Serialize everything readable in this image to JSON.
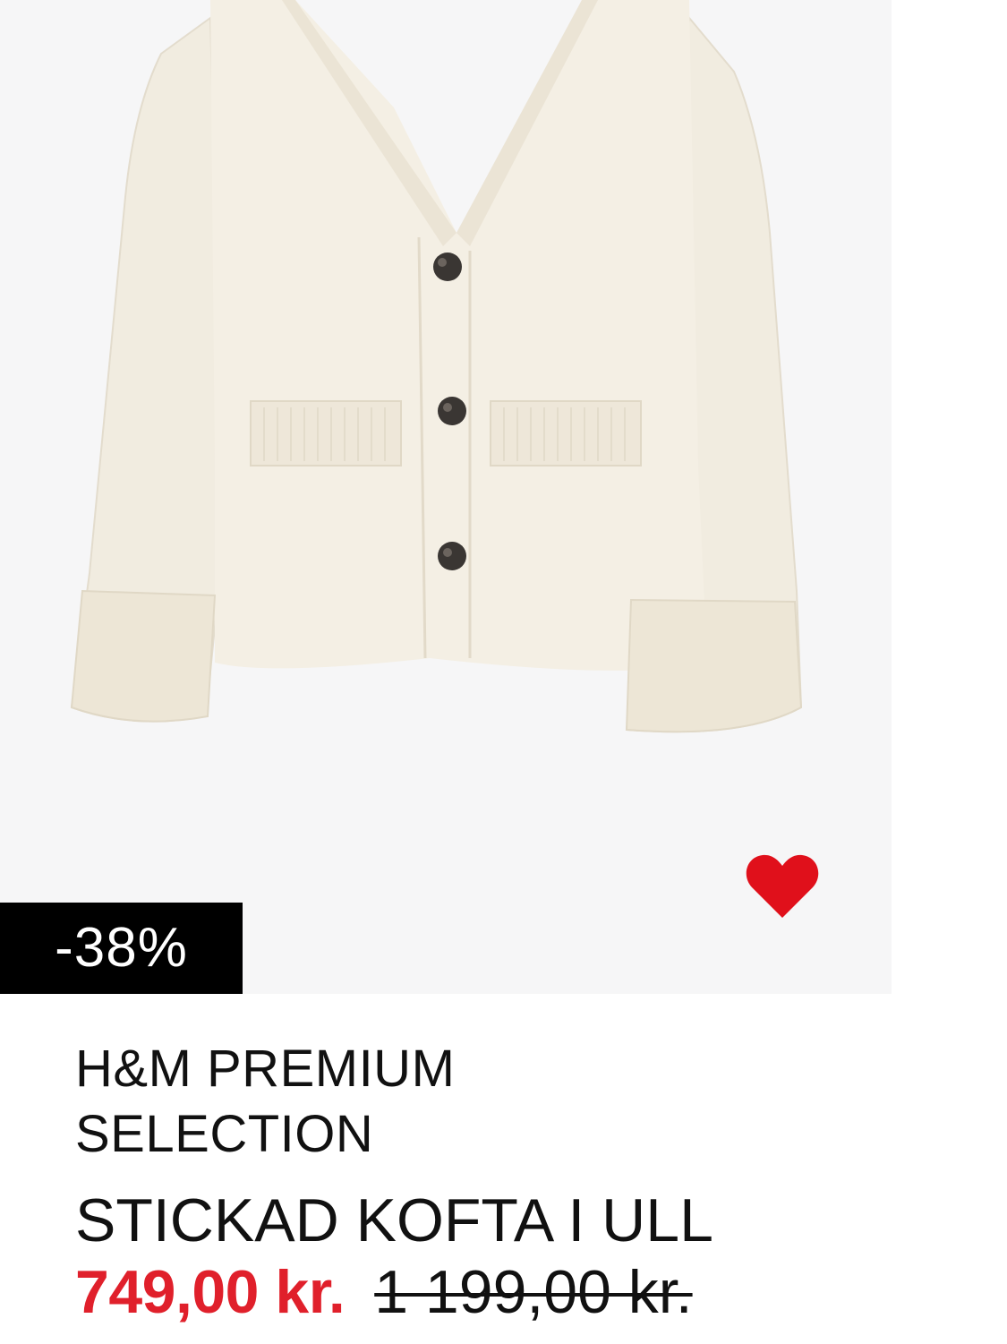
{
  "product": {
    "discount_badge": "-38%",
    "brand": "H&M PREMIUM SELECTION",
    "title": "STICKAD KOFTA I ULL",
    "sale_price": "749,00 kr.",
    "original_price": "1 199,00 kr.",
    "image_icon": "cardigan-photo",
    "favorite_icon": "heart-icon",
    "colors": {
      "badge_bg": "#000000",
      "sale_price": "#e0202b",
      "heart": "#e0101b",
      "image_bg": "#f6f6f7"
    }
  }
}
